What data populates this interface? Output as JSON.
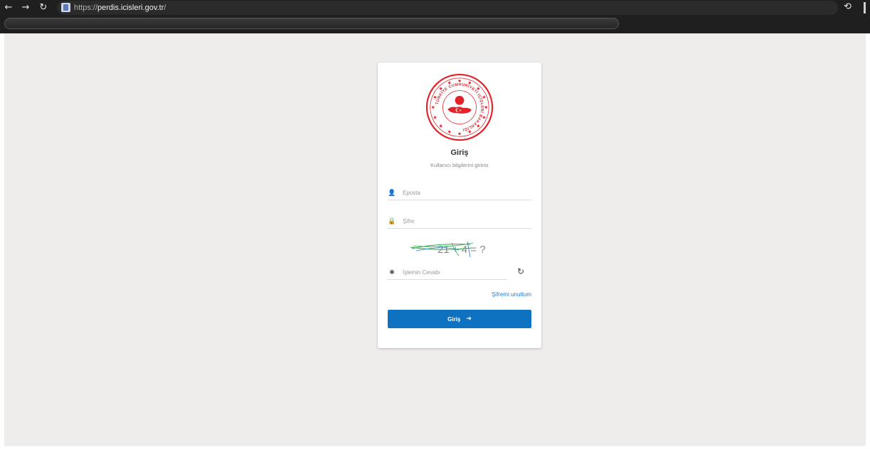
{
  "browser": {
    "url_scheme": "https://",
    "url_host": "perdis.icisleri.gov.tr",
    "url_path": "/",
    "icons": {
      "back": "back-arrow-icon",
      "forward": "forward-arrow-icon",
      "reload": "reload-icon",
      "site": "page-icon",
      "extension": "extension-icon"
    }
  },
  "login": {
    "seal_text": "TÜRKİYE CUMHURİYETİ İÇİŞLERİ BAKANLIĞI",
    "title": "Giriş",
    "subtitle": "Kullanıcı bilgilerini giriniz",
    "email_placeholder": "Eposta",
    "email_value": "",
    "password_placeholder": "Şifre",
    "password_value": "",
    "captcha_text": "21 + 4 = ?",
    "answer_placeholder": "İşlemin Cevabı",
    "answer_value": "",
    "forgot_label": "Şifremi unuttum",
    "submit_label": "Giriş"
  },
  "colors": {
    "accent": "#0f72c1",
    "link": "#1e7bd0",
    "seal_red": "#e2232a",
    "background": "#efecec"
  }
}
